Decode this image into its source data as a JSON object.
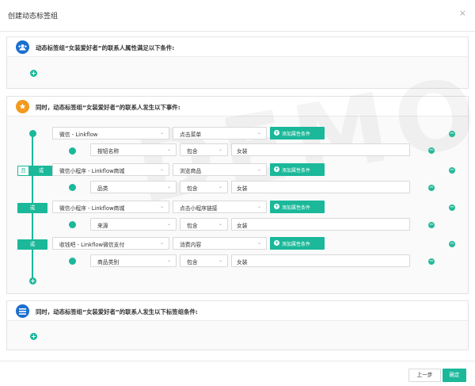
{
  "modal": {
    "title": "创建动态标签组",
    "close_icon": "×"
  },
  "watermark": "DEMO",
  "section1": {
    "title": "动态标签组“女装爱好者”的联系人属性满足以下条件:",
    "badge_icon": "users-icon"
  },
  "section2": {
    "title": "同时，动态标签组“女装爱好者”的联系人发生以下事件:",
    "badge_icon": "star-icon",
    "and_label": "且",
    "or_label": "或",
    "add_attr_label": "添加属性条件",
    "events": [
      {
        "channel": "微信 - Linkflow",
        "event": "点击菜单",
        "cond_field": "按钮名称",
        "cond_op": "包含",
        "cond_value": "女装"
      },
      {
        "channel": "微信小程序 - Linkflow商城",
        "event": "浏览商品",
        "cond_field": "品类",
        "cond_op": "包含",
        "cond_value": "女装"
      },
      {
        "channel": "微信小程序 - Linkflow商城",
        "event": "点击小程序链接",
        "cond_field": "来源",
        "cond_op": "包含",
        "cond_value": "女装"
      },
      {
        "channel": "收钱吧 - Linkflow微信支付",
        "event": "消费内容",
        "cond_field": "商品类别",
        "cond_op": "包含",
        "cond_value": "女装"
      }
    ]
  },
  "section3": {
    "title": "同时，动态标签组“女装爱好者”的联系人发生以下标签组条件:",
    "badge_icon": "list-icon"
  },
  "footer": {
    "prev_label": "上一步",
    "ok_label": "确定"
  },
  "colors": {
    "accent": "#1bb89a",
    "blue": "#1b6fd0",
    "orange": "#f39a1e"
  }
}
